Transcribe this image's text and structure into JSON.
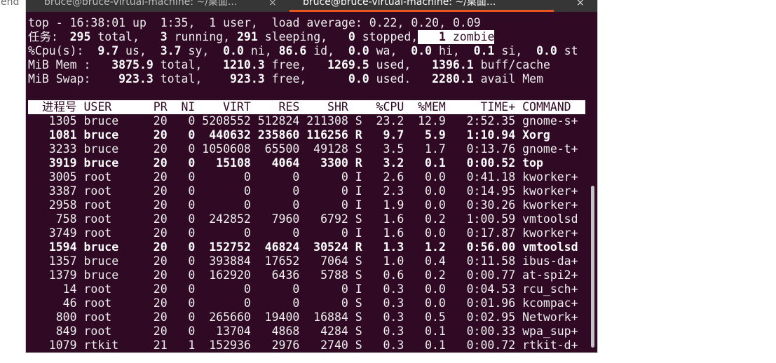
{
  "window": {
    "edge_text": "end"
  },
  "colors": {
    "background": "#300a24",
    "foreground": "#eeeeee",
    "bold_foreground": "#ffffff",
    "header_background": "#ffffff",
    "accent": "#e95420",
    "tab_bar": "#363636"
  },
  "tabs": [
    {
      "title": "bruce@bruce-virtual-machine: ~/桌面...",
      "close": "×",
      "active": false
    },
    {
      "title": "bruce@bruce-virtual-machine: ~/桌面...",
      "close": "×",
      "active": true
    }
  ],
  "summary": {
    "uptime": [
      {
        "t": "top - 16:38:01 up  1:35,  1 user,  load average: 0.22, 0.20, 0.09"
      }
    ],
    "tasks": [
      {
        "t": "任务: "
      },
      {
        "t": "295",
        "b": true
      },
      {
        "t": " total,   "
      },
      {
        "t": "3",
        "b": true
      },
      {
        "t": " running, "
      },
      {
        "t": "291",
        "b": true
      },
      {
        "t": " sleeping,   "
      },
      {
        "t": "0",
        "b": true
      },
      {
        "t": " stopped,"
      },
      {
        "t": "   ",
        "inv": true
      },
      {
        "t": "1",
        "b": true,
        "inv": true
      },
      {
        "t": " zombie",
        "inv": true
      }
    ],
    "cpu": [
      {
        "t": "%Cpu(s):  "
      },
      {
        "t": "9.7",
        "b": true
      },
      {
        "t": " us,  "
      },
      {
        "t": "3.7",
        "b": true
      },
      {
        "t": " sy,  "
      },
      {
        "t": "0.0",
        "b": true
      },
      {
        "t": " ni, "
      },
      {
        "t": "86.6",
        "b": true
      },
      {
        "t": " id,  "
      },
      {
        "t": "0.0",
        "b": true
      },
      {
        "t": " wa,  "
      },
      {
        "t": "0.0",
        "b": true
      },
      {
        "t": " hi,  "
      },
      {
        "t": "0.1",
        "b": true
      },
      {
        "t": " si,  "
      },
      {
        "t": "0.0",
        "b": true
      },
      {
        "t": " st"
      }
    ],
    "mem": [
      {
        "t": "MiB Mem :   "
      },
      {
        "t": "3875.9",
        "b": true
      },
      {
        "t": " total,   "
      },
      {
        "t": "1210.3",
        "b": true
      },
      {
        "t": " free,   "
      },
      {
        "t": "1269.5",
        "b": true
      },
      {
        "t": " used,   "
      },
      {
        "t": "1396.1",
        "b": true
      },
      {
        "t": " buff/cache"
      }
    ],
    "swap": [
      {
        "t": "MiB Swap:    "
      },
      {
        "t": "923.3",
        "b": true
      },
      {
        "t": " total,    "
      },
      {
        "t": "923.3",
        "b": true
      },
      {
        "t": " free,      "
      },
      {
        "t": "0.0",
        "b": true
      },
      {
        "t": " used.   "
      },
      {
        "t": "2280.1",
        "b": true
      },
      {
        "t": " avail Mem"
      }
    ]
  },
  "process_table": {
    "headers": {
      "pid": "进程号",
      "user": "USER",
      "pr": "PR",
      "ni": "NI",
      "virt": "VIRT",
      "res": "RES",
      "shr": "SHR",
      "cpu": "%CPU",
      "mem": "%MEM",
      "time": "TIME+",
      "command": "COMMAND"
    },
    "rows": [
      {
        "pid": "1305",
        "user": "bruce",
        "pr": "20",
        "ni": "0",
        "virt": "5208552",
        "res": "512824",
        "shr": "211308",
        "s": "S",
        "cpu": "23.2",
        "mem": "12.9",
        "time": "2:52.35",
        "command": "gnome-s+"
      },
      {
        "pid": "1081",
        "user": "bruce",
        "pr": "20",
        "ni": "0",
        "virt": "440632",
        "res": "235860",
        "shr": "116256",
        "s": "R",
        "cpu": "9.7",
        "mem": "5.9",
        "time": "1:10.94",
        "command": "Xorg"
      },
      {
        "pid": "3233",
        "user": "bruce",
        "pr": "20",
        "ni": "0",
        "virt": "1050608",
        "res": "65500",
        "shr": "49128",
        "s": "S",
        "cpu": "3.5",
        "mem": "1.7",
        "time": "0:13.76",
        "command": "gnome-t+"
      },
      {
        "pid": "3919",
        "user": "bruce",
        "pr": "20",
        "ni": "0",
        "virt": "15108",
        "res": "4064",
        "shr": "3300",
        "s": "R",
        "cpu": "3.2",
        "mem": "0.1",
        "time": "0:00.52",
        "command": "top"
      },
      {
        "pid": "3005",
        "user": "root",
        "pr": "20",
        "ni": "0",
        "virt": "0",
        "res": "0",
        "shr": "0",
        "s": "I",
        "cpu": "2.6",
        "mem": "0.0",
        "time": "0:41.18",
        "command": "kworker+"
      },
      {
        "pid": "3387",
        "user": "root",
        "pr": "20",
        "ni": "0",
        "virt": "0",
        "res": "0",
        "shr": "0",
        "s": "I",
        "cpu": "2.3",
        "mem": "0.0",
        "time": "0:14.95",
        "command": "kworker+"
      },
      {
        "pid": "2958",
        "user": "root",
        "pr": "20",
        "ni": "0",
        "virt": "0",
        "res": "0",
        "shr": "0",
        "s": "I",
        "cpu": "1.9",
        "mem": "0.0",
        "time": "0:30.26",
        "command": "kworker+"
      },
      {
        "pid": "758",
        "user": "root",
        "pr": "20",
        "ni": "0",
        "virt": "242852",
        "res": "7960",
        "shr": "6792",
        "s": "S",
        "cpu": "1.6",
        "mem": "0.2",
        "time": "1:00.59",
        "command": "vmtoolsd"
      },
      {
        "pid": "3749",
        "user": "root",
        "pr": "20",
        "ni": "0",
        "virt": "0",
        "res": "0",
        "shr": "0",
        "s": "I",
        "cpu": "1.6",
        "mem": "0.0",
        "time": "0:17.87",
        "command": "kworker+"
      },
      {
        "pid": "1594",
        "user": "bruce",
        "pr": "20",
        "ni": "0",
        "virt": "152752",
        "res": "46824",
        "shr": "30524",
        "s": "R",
        "cpu": "1.3",
        "mem": "1.2",
        "time": "0:56.00",
        "command": "vmtoolsd"
      },
      {
        "pid": "1357",
        "user": "bruce",
        "pr": "20",
        "ni": "0",
        "virt": "393884",
        "res": "17652",
        "shr": "7064",
        "s": "S",
        "cpu": "1.0",
        "mem": "0.4",
        "time": "0:11.58",
        "command": "ibus-da+"
      },
      {
        "pid": "1379",
        "user": "bruce",
        "pr": "20",
        "ni": "0",
        "virt": "162920",
        "res": "6436",
        "shr": "5788",
        "s": "S",
        "cpu": "0.6",
        "mem": "0.2",
        "time": "0:00.77",
        "command": "at-spi2+"
      },
      {
        "pid": "14",
        "user": "root",
        "pr": "20",
        "ni": "0",
        "virt": "0",
        "res": "0",
        "shr": "0",
        "s": "I",
        "cpu": "0.3",
        "mem": "0.0",
        "time": "0:04.53",
        "command": "rcu_sch+"
      },
      {
        "pid": "46",
        "user": "root",
        "pr": "20",
        "ni": "0",
        "virt": "0",
        "res": "0",
        "shr": "0",
        "s": "S",
        "cpu": "0.3",
        "mem": "0.0",
        "time": "0:01.96",
        "command": "kcompac+"
      },
      {
        "pid": "800",
        "user": "root",
        "pr": "20",
        "ni": "0",
        "virt": "265660",
        "res": "19400",
        "shr": "16884",
        "s": "S",
        "cpu": "0.3",
        "mem": "0.5",
        "time": "0:02.95",
        "command": "Network+"
      },
      {
        "pid": "849",
        "user": "root",
        "pr": "20",
        "ni": "0",
        "virt": "13704",
        "res": "4868",
        "shr": "4284",
        "s": "S",
        "cpu": "0.3",
        "mem": "0.1",
        "time": "0:00.33",
        "command": "wpa_sup+"
      },
      {
        "pid": "1079",
        "user": "rtkit",
        "pr": "21",
        "ni": "1",
        "virt": "152936",
        "res": "2976",
        "shr": "2740",
        "s": "S",
        "cpu": "0.3",
        "mem": "0.1",
        "time": "0:00.72",
        "command": "rtkit-d+"
      }
    ]
  }
}
